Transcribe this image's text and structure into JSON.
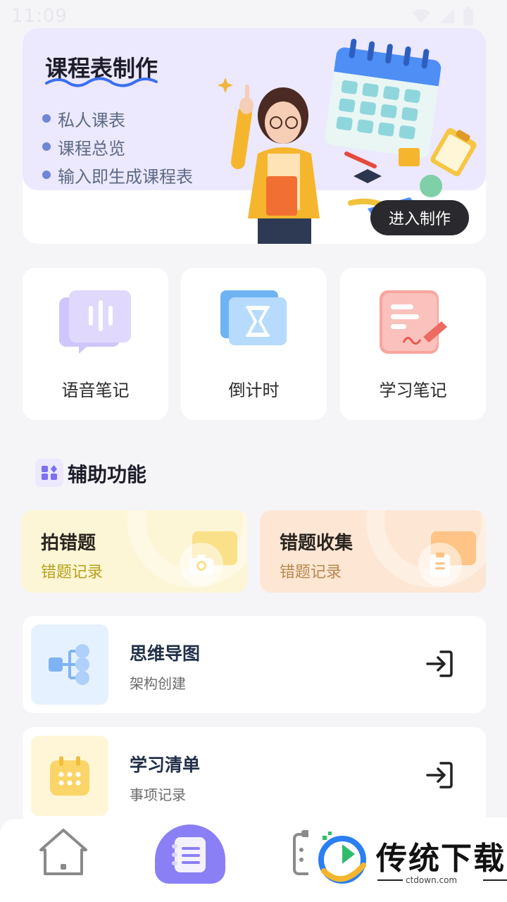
{
  "status_bar": {
    "time": "11:09",
    "icons": [
      "wifi-icon",
      "cell-signal-icon",
      "battery-icon"
    ]
  },
  "banner": {
    "title": "课程表制作",
    "bullets": [
      "私人课表",
      "课程总览",
      "输入即生成课程表"
    ],
    "cta": "进入制作"
  },
  "features": [
    {
      "label": "语音笔记",
      "icon": "voice-note-icon"
    },
    {
      "label": "倒计时",
      "icon": "hourglass-icon"
    },
    {
      "label": "学习笔记",
      "icon": "study-note-icon"
    }
  ],
  "aux_section": {
    "title": "辅助功能",
    "icon": "grid-icon"
  },
  "aux_cards": [
    {
      "title": "拍错题",
      "subtitle": "错题记录",
      "icon": "camera-icon",
      "bg": "#fdf6d6",
      "accent": "#b8a11a",
      "rect": "#fbe08a"
    },
    {
      "title": "错题收集",
      "subtitle": "错题记录",
      "icon": "clipboard-icon",
      "bg": "#fde6d4",
      "accent": "#b8894e",
      "rect": "#ffc486"
    }
  ],
  "list_items": [
    {
      "title": "思维导图",
      "subtitle": "架构创建",
      "icon": "mind-map-icon",
      "thumb_bg": "#e6f1ff"
    },
    {
      "title": "学习清单",
      "subtitle": "事项记录",
      "icon": "calendar-icon",
      "thumb_bg": "#fff6d7"
    }
  ],
  "bottom_nav": [
    {
      "name": "home",
      "icon": "home-icon"
    },
    {
      "name": "notes",
      "icon": "notes-icon",
      "active": true
    },
    {
      "name": "list",
      "icon": "list-icon"
    }
  ],
  "watermark": {
    "text": "传统下载",
    "url": "ctdown.com"
  },
  "colors": {
    "page_bg": "#f5f5f8",
    "banner_lavender": "#ece8fd",
    "accent_purple": "#8b7ff6",
    "cta_bg": "#2a2a2e"
  }
}
